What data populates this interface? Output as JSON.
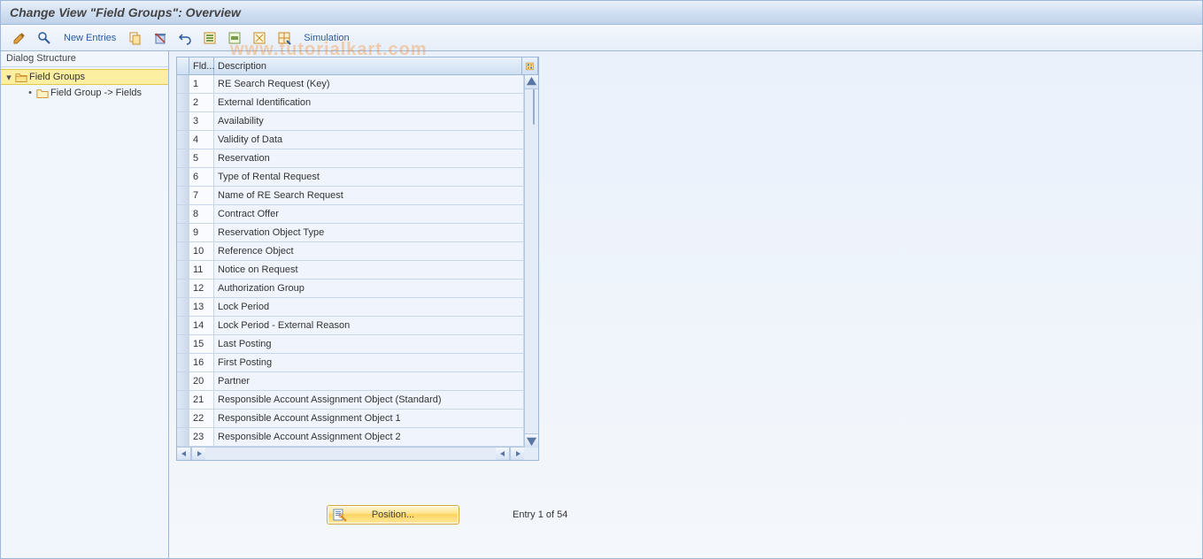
{
  "title": "Change View \"Field Groups\": Overview",
  "watermark": "www.tutorialkart.com",
  "toolbar": {
    "new_entries": "New Entries",
    "simulation": "Simulation"
  },
  "sidebar": {
    "title": "Dialog Structure",
    "items": [
      {
        "label": "Field Groups",
        "expanded": true,
        "selected": true,
        "open": true
      },
      {
        "label": "Field Group -> Fields",
        "expanded": false,
        "selected": false,
        "open": false
      }
    ]
  },
  "table": {
    "header": {
      "fld": "Fld...",
      "desc": "Description"
    },
    "rows": [
      {
        "fld": "1",
        "desc": "RE Search Request (Key)"
      },
      {
        "fld": "2",
        "desc": "External Identification"
      },
      {
        "fld": "3",
        "desc": "Availability"
      },
      {
        "fld": "4",
        "desc": "Validity of Data"
      },
      {
        "fld": "5",
        "desc": "Reservation"
      },
      {
        "fld": "6",
        "desc": "Type of Rental Request"
      },
      {
        "fld": "7",
        "desc": "Name of RE Search Request"
      },
      {
        "fld": "8",
        "desc": "Contract Offer"
      },
      {
        "fld": "9",
        "desc": "Reservation Object Type"
      },
      {
        "fld": "10",
        "desc": "Reference Object"
      },
      {
        "fld": "11",
        "desc": "Notice on Request"
      },
      {
        "fld": "12",
        "desc": "Authorization Group"
      },
      {
        "fld": "13",
        "desc": "Lock Period"
      },
      {
        "fld": "14",
        "desc": "Lock Period - External Reason"
      },
      {
        "fld": "15",
        "desc": "Last Posting"
      },
      {
        "fld": "16",
        "desc": "First Posting"
      },
      {
        "fld": "20",
        "desc": "Partner"
      },
      {
        "fld": "21",
        "desc": "Responsible Account Assignment Object (Standard)"
      },
      {
        "fld": "22",
        "desc": "Responsible Account Assignment Object 1"
      },
      {
        "fld": "23",
        "desc": "Responsible Account Assignment Object 2"
      }
    ]
  },
  "pager": {
    "position_label": "Position...",
    "status": "Entry 1 of 54"
  }
}
